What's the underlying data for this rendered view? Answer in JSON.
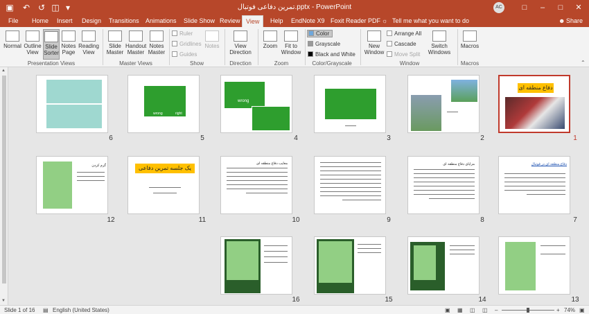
{
  "titlebar": {
    "title": "تمرین دفاعی فوتبال.pptx - PowerPoint",
    "avatar_initials": "AC",
    "colors": {
      "accent": "#b7472a"
    }
  },
  "tabs": [
    "File",
    "Home",
    "Insert",
    "Design",
    "Transitions",
    "Animations",
    "Slide Show",
    "Review",
    "View",
    "Help",
    "EndNote X9",
    "Foxit Reader PDF"
  ],
  "active_tab": "View",
  "tellme": "Tell me what you want to do",
  "share": "Share",
  "ribbon": {
    "presentation_views": {
      "label": "Presentation Views",
      "normal": "Normal",
      "outline": "Outline View",
      "sorter": "Slide Sorter",
      "notes": "Notes Page",
      "reading": "Reading View"
    },
    "master_views": {
      "label": "Master Views",
      "slide": "Slide Master",
      "handout": "Handout Master",
      "notes": "Notes Master"
    },
    "show": {
      "label": "Show",
      "ruler": "Ruler",
      "gridlines": "Gridlines",
      "guides": "Guides",
      "notes": "Notes"
    },
    "direction": {
      "label": "Direction",
      "view_direction": "View Direction"
    },
    "zoom": {
      "label": "Zoom",
      "zoom": "Zoom",
      "fit": "Fit to Window"
    },
    "color": {
      "label": "Color/Grayscale",
      "color": "Color",
      "grayscale": "Grayscale",
      "bw": "Black and White"
    },
    "window": {
      "label": "Window",
      "new": "New Window",
      "arrange": "Arrange All",
      "cascade": "Cascade",
      "move_split": "Move Split",
      "switch": "Switch Windows"
    },
    "macros": {
      "label": "Macros",
      "macros": "Macros"
    }
  },
  "slides": [
    {
      "n": "1",
      "title": "دفاع منطقه ای"
    },
    {
      "n": "2"
    },
    {
      "n": "3"
    },
    {
      "n": "4",
      "label": "wrong"
    },
    {
      "n": "5",
      "labels": [
        "wrong",
        "right"
      ]
    },
    {
      "n": "6"
    },
    {
      "n": "7",
      "heading": "دفاع منطقه ای در فوتبال"
    },
    {
      "n": "8",
      "heading": "مزایای دفاع منطقه ای"
    },
    {
      "n": "9"
    },
    {
      "n": "10",
      "heading": "معایب دفاع منطقه ای"
    },
    {
      "n": "11",
      "title": "یک جلسه تمرین دفاعی"
    },
    {
      "n": "12",
      "heading": "گرم کردن"
    },
    {
      "n": "13"
    },
    {
      "n": "14"
    },
    {
      "n": "15"
    },
    {
      "n": "16"
    }
  ],
  "status": {
    "slide": "Slide 1 of 16",
    "language": "English (United States)",
    "zoom": "74%"
  }
}
